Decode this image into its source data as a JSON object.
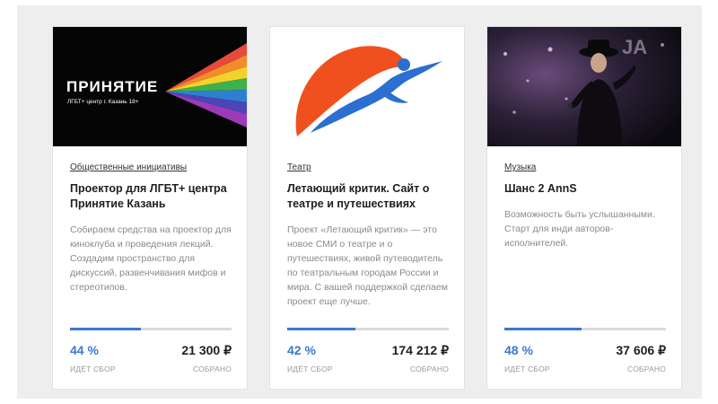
{
  "cards": [
    {
      "cover_logo": "ПРИНЯТИЕ",
      "cover_subtitle": "ЛГБТ+ центр г. Казань 18+",
      "category": "Общественные инициативы",
      "title": "Проектор для ЛГБТ+ центра Принятие Казань",
      "description": "Собираем средства на проектор для киноклуба и проведения лекций. Создадим пространство для дискуссий, развенчивания мифов и стереотипов.",
      "progress_percent": 44,
      "percent_label": "44 %",
      "amount": "21 300 ₽",
      "label_left": "ИДЁТ СБОР",
      "label_right": "СОБРАНО"
    },
    {
      "category": "Театр",
      "title": "Летающий критик. Сайт о театре и путешествиях",
      "description": "Проект «Летающий критик» — это новое СМИ о театре и о путешествиях, живой путеводитель по театральным городам России и мира. С вашей поддержкой сделаем проект еще лучше.",
      "progress_percent": 42,
      "percent_label": "42 %",
      "amount": "174 212 ₽",
      "label_left": "ИДЁТ СБОР",
      "label_right": "СОБРАНО"
    },
    {
      "category": "Музыка",
      "title": "Шанс 2 AnnS",
      "description": "Возможность быть услышанными. Старт для инди авторов-исполнителей.",
      "progress_percent": 48,
      "percent_label": "48 %",
      "amount": "37 606 ₽",
      "label_left": "ИДЁТ СБОР",
      "label_right": "СОБРАНО"
    }
  ],
  "colors": {
    "accent": "#3a78d0",
    "logo_orange": "#f0501e",
    "logo_blue": "#2b6fd1"
  },
  "icons": [
    "rainbow-logo-icon",
    "flying-critic-logo-icon",
    "singer-photo"
  ]
}
